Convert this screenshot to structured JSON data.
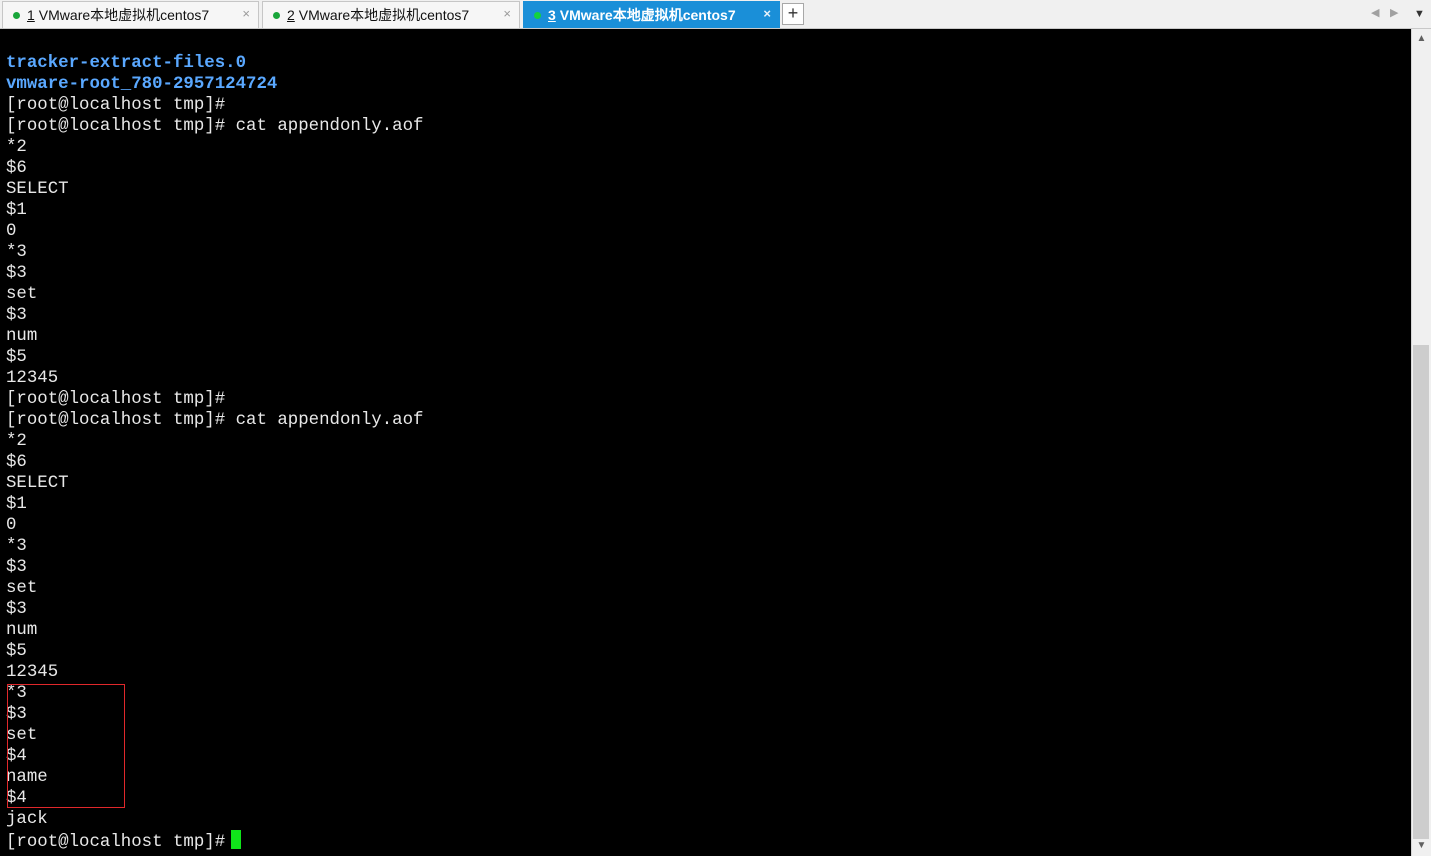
{
  "tabs": [
    {
      "num": "1",
      "title": "VMware本地虚拟机centos7",
      "active": false
    },
    {
      "num": "2",
      "title": "VMware本地虚拟机centos7",
      "active": false
    },
    {
      "num": "3",
      "title": "VMware本地虚拟机centos7",
      "active": true
    }
  ],
  "tab_close_glyph": "×",
  "add_tab_glyph": "+",
  "nav": {
    "prev": "◀",
    "next": "▶",
    "menu": "▼"
  },
  "scrollbar": {
    "up": "▲",
    "down": "▼",
    "thumb_position_fraction": 0.38
  },
  "terminal": {
    "lines": [
      {
        "text": "tracker-extract-files.0",
        "style": "dir"
      },
      {
        "text": "vmware-root_780-2957124724",
        "style": "dir"
      },
      {
        "text": "[root@localhost tmp]#",
        "style": "normal"
      },
      {
        "text": "[root@localhost tmp]# cat appendonly.aof",
        "style": "normal"
      },
      {
        "text": "*2",
        "style": "normal"
      },
      {
        "text": "$6",
        "style": "normal"
      },
      {
        "text": "SELECT",
        "style": "normal"
      },
      {
        "text": "$1",
        "style": "normal"
      },
      {
        "text": "0",
        "style": "normal"
      },
      {
        "text": "*3",
        "style": "normal"
      },
      {
        "text": "$3",
        "style": "normal"
      },
      {
        "text": "set",
        "style": "normal"
      },
      {
        "text": "$3",
        "style": "normal"
      },
      {
        "text": "num",
        "style": "normal"
      },
      {
        "text": "$5",
        "style": "normal"
      },
      {
        "text": "12345",
        "style": "normal"
      },
      {
        "text": "[root@localhost tmp]#",
        "style": "normal"
      },
      {
        "text": "[root@localhost tmp]# cat appendonly.aof",
        "style": "normal"
      },
      {
        "text": "*2",
        "style": "normal"
      },
      {
        "text": "$6",
        "style": "normal"
      },
      {
        "text": "SELECT",
        "style": "normal"
      },
      {
        "text": "$1",
        "style": "normal"
      },
      {
        "text": "0",
        "style": "normal"
      },
      {
        "text": "*3",
        "style": "normal"
      },
      {
        "text": "$3",
        "style": "normal"
      },
      {
        "text": "set",
        "style": "normal"
      },
      {
        "text": "$3",
        "style": "normal"
      },
      {
        "text": "num",
        "style": "normal"
      },
      {
        "text": "$5",
        "style": "normal"
      },
      {
        "text": "12345",
        "style": "normal"
      },
      {
        "text": "*3",
        "style": "normal"
      },
      {
        "text": "$3",
        "style": "normal"
      },
      {
        "text": "set",
        "style": "normal"
      },
      {
        "text": "$4",
        "style": "normal"
      },
      {
        "text": "name",
        "style": "normal"
      },
      {
        "text": "$4",
        "style": "normal"
      },
      {
        "text": "jack",
        "style": "normal"
      }
    ],
    "prompt": "[root@localhost tmp]#"
  },
  "colors": {
    "background": "#000000",
    "text": "#e8e8e8",
    "directory": "#5aa8ff",
    "cursor": "#10e41a",
    "highlight_box": "#e0282b",
    "active_tab": "#1a8fd8",
    "status_dot": "#19a63a"
  }
}
